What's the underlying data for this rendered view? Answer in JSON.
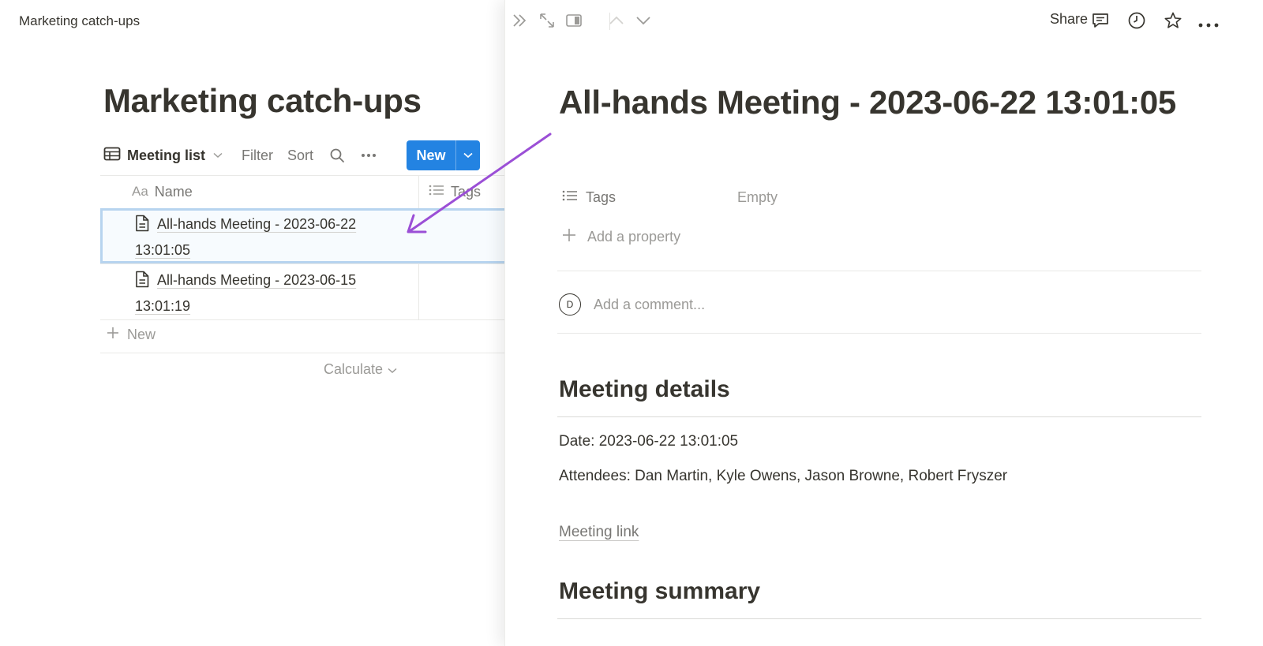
{
  "topbar": {
    "breadcrumb": "Marketing catch-ups"
  },
  "database": {
    "title": "Marketing catch-ups",
    "view_label": "Meeting list",
    "filter_label": "Filter",
    "sort_label": "Sort",
    "new_label": "New",
    "columns": [
      {
        "prefix": "Aa",
        "label": "Name"
      },
      {
        "label": "Tags"
      }
    ],
    "rows": [
      {
        "name": "All-hands Meeting - 2023-06-22 13:01:05",
        "selected": true
      },
      {
        "name": "All-hands Meeting - 2023-06-15 13:01:19",
        "selected": false
      }
    ],
    "add_row_label": "New",
    "calculate_label": "Calculate"
  },
  "peek": {
    "share_label": "Share",
    "title": "All-hands Meeting - 2023-06-22 13:01:05",
    "properties": [
      {
        "name": "Tags",
        "value": "Empty",
        "icon": "list-icon"
      }
    ],
    "add_property_label": "Add a property",
    "comment": {
      "avatar_initial": "D",
      "placeholder": "Add a comment..."
    },
    "sections": [
      {
        "heading": "Meeting details"
      },
      {
        "heading": "Meeting summary"
      }
    ],
    "details": {
      "date": "Date: 2023-06-22 13:01:05",
      "attendees": "Attendees: Dan Martin, Kyle Owens, Jason Browne, Robert Fryszer"
    },
    "meeting_link_label": "Meeting link"
  },
  "colors": {
    "accent": "#2383e2",
    "annotation_arrow": "#9b4fd6",
    "text": "#37352f",
    "muted": "#9b9a97"
  }
}
